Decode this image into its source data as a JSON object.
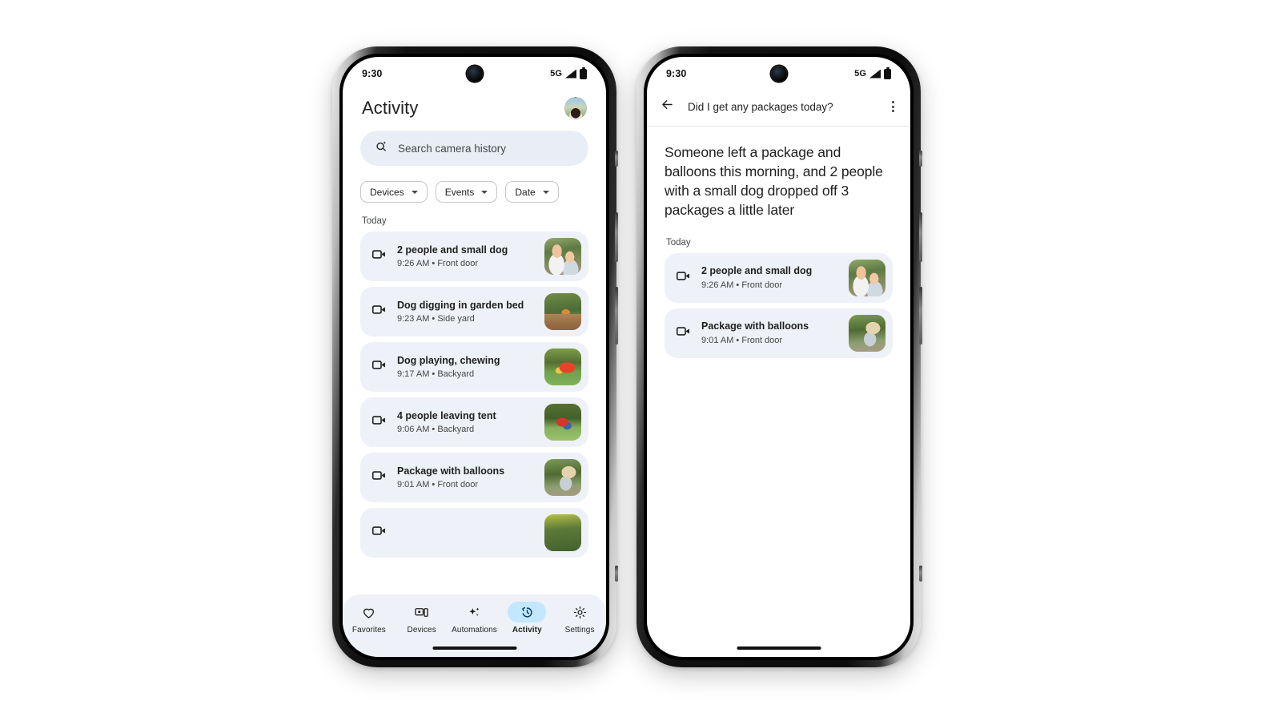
{
  "status_bar": {
    "time": "9:30",
    "network": "5G",
    "signal_icon": "signal-bars-icon",
    "battery_icon": "battery-icon",
    "camera_icon": "front-camera-icon"
  },
  "left_phone": {
    "header": {
      "title": "Activity",
      "avatar_name": "user-avatar"
    },
    "search": {
      "placeholder": "Search camera history",
      "icon": "ai-search-icon"
    },
    "filters": [
      {
        "label": "Devices",
        "icon": "chevron-down-icon"
      },
      {
        "label": "Events",
        "icon": "chevron-down-icon"
      },
      {
        "label": "Date",
        "icon": "chevron-down-icon"
      }
    ],
    "section_label": "Today",
    "events": [
      {
        "title": "2 people and small dog",
        "meta": "9:26 AM • Front door",
        "icon": "video-camera-icon",
        "thumb_class": "th-people"
      },
      {
        "title": "Dog digging in garden bed",
        "meta": "9:23 AM • Side yard",
        "icon": "video-camera-icon",
        "thumb_class": "th-garden"
      },
      {
        "title": "Dog playing, chewing",
        "meta": "9:17 AM • Backyard",
        "icon": "video-camera-icon",
        "thumb_class": "th-playing"
      },
      {
        "title": "4 people leaving tent",
        "meta": "9:06 AM • Backyard",
        "icon": "video-camera-icon",
        "thumb_class": "th-tent"
      },
      {
        "title": "Package with balloons",
        "meta": "9:01 AM • Front door",
        "icon": "video-camera-icon",
        "thumb_class": "th-package"
      }
    ],
    "bottom_nav": [
      {
        "label": "Favorites",
        "icon": "heart-icon",
        "active": false
      },
      {
        "label": "Devices",
        "icon": "devices-icon",
        "active": false
      },
      {
        "label": "Automations",
        "icon": "sparkle-icon",
        "active": false
      },
      {
        "label": "Activity",
        "icon": "history-icon",
        "active": true
      },
      {
        "label": "Settings",
        "icon": "gear-icon",
        "active": false
      }
    ]
  },
  "right_phone": {
    "header": {
      "back_icon": "back-arrow-icon",
      "title": "Did I get any packages today?",
      "overflow_icon": "overflow-menu-icon"
    },
    "summary": "Someone left a package and balloons this morning, and 2 people with a small dog dropped off 3 packages a little later",
    "section_label": "Today",
    "events": [
      {
        "title": "2 people and small dog",
        "meta": "9:26 AM • Front door",
        "icon": "video-camera-icon",
        "thumb_class": "th-people"
      },
      {
        "title": "Package with balloons",
        "meta": "9:01 AM • Front door",
        "icon": "video-camera-icon",
        "thumb_class": "th-package"
      }
    ]
  },
  "colors": {
    "card_bg": "#eef1f7",
    "search_bg": "#e9eef6",
    "active_pill": "#c2e7ff",
    "text_primary": "#1f1f1f",
    "text_secondary": "#444746"
  }
}
